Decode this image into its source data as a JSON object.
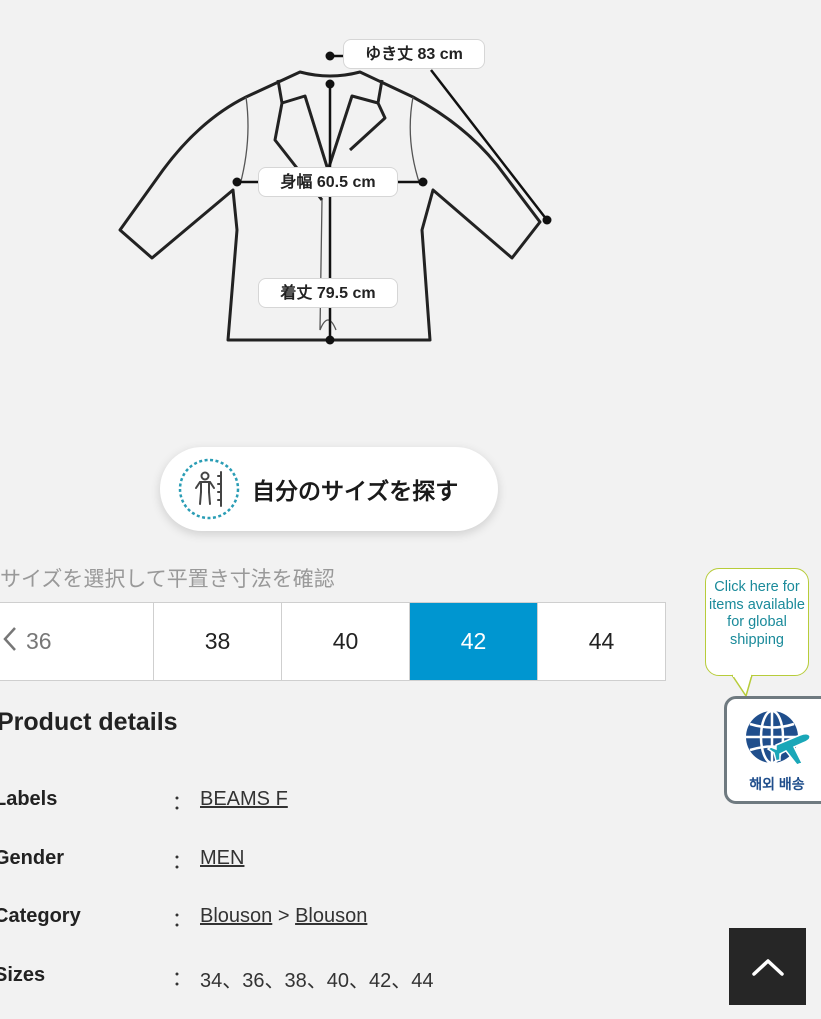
{
  "diagram": {
    "sleeve_label": "ゆき丈 83 cm",
    "width_label": "身幅 60.5 cm",
    "length_label": "着丈 79.5 cm"
  },
  "find_size_button": {
    "icon": "person-measure-icon",
    "label": "自分のサイズを探す"
  },
  "size_selector": {
    "caption": "サイズを選択して平置き寸法を確認",
    "prev_icon": "chevron-left-icon",
    "sizes": [
      "36",
      "38",
      "40",
      "42",
      "44"
    ],
    "selected": "42",
    "active_color": "#0096d0"
  },
  "product_details": {
    "title": "Product details",
    "rows": [
      {
        "key": "Labels",
        "colon": "：",
        "value": "BEAMS F"
      },
      {
        "key": "Gender",
        "colon": "：",
        "value": "MEN"
      },
      {
        "key": "Category",
        "colon": "：",
        "value_parts": [
          "Blouson",
          ">",
          "Blouson"
        ]
      },
      {
        "key": "Sizes",
        "colon": "：",
        "value": "34、36、38、40、42、44"
      }
    ]
  },
  "global_shipping": {
    "bubble_text": "Click here for items available for global shipping",
    "icon": "globe-airplane-icon",
    "button_label": "해외 배송"
  },
  "scroll_top": {
    "icon": "chevron-up-icon"
  }
}
